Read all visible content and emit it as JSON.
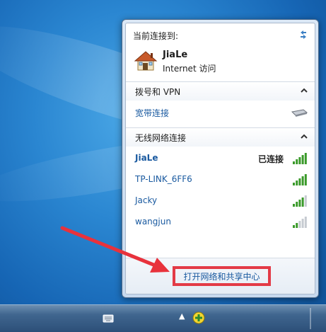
{
  "flyout": {
    "current_label": "当前连接到:",
    "current_connection": {
      "name": "JiaLe",
      "status": "Internet 访问"
    },
    "dialup_section": {
      "title": "拨号和 VPN",
      "items": [
        {
          "name": "宽带连接"
        }
      ]
    },
    "wireless_section": {
      "title": "无线网络连接",
      "networks": [
        {
          "name": "JiaLe",
          "state": "已连接",
          "signal_bars": 5
        },
        {
          "name": "TP-LINK_6FF6",
          "state": "",
          "signal_bars": 5
        },
        {
          "name": "Jacky",
          "state": "",
          "signal_bars": 4
        },
        {
          "name": "wangjun",
          "state": "",
          "signal_bars": 2
        }
      ]
    },
    "footer": {
      "open_center_label": "打开网络和共享中心"
    }
  },
  "colors": {
    "link": "#1a5aa0",
    "signal_green": "#3a9a2a",
    "highlight_red": "#e33a46"
  },
  "icons": [
    "refresh-icon",
    "house-icon",
    "chevron-up-icon",
    "broadband-icon",
    "signal-icon",
    "keyboard-icon",
    "network-tray-icon"
  ]
}
